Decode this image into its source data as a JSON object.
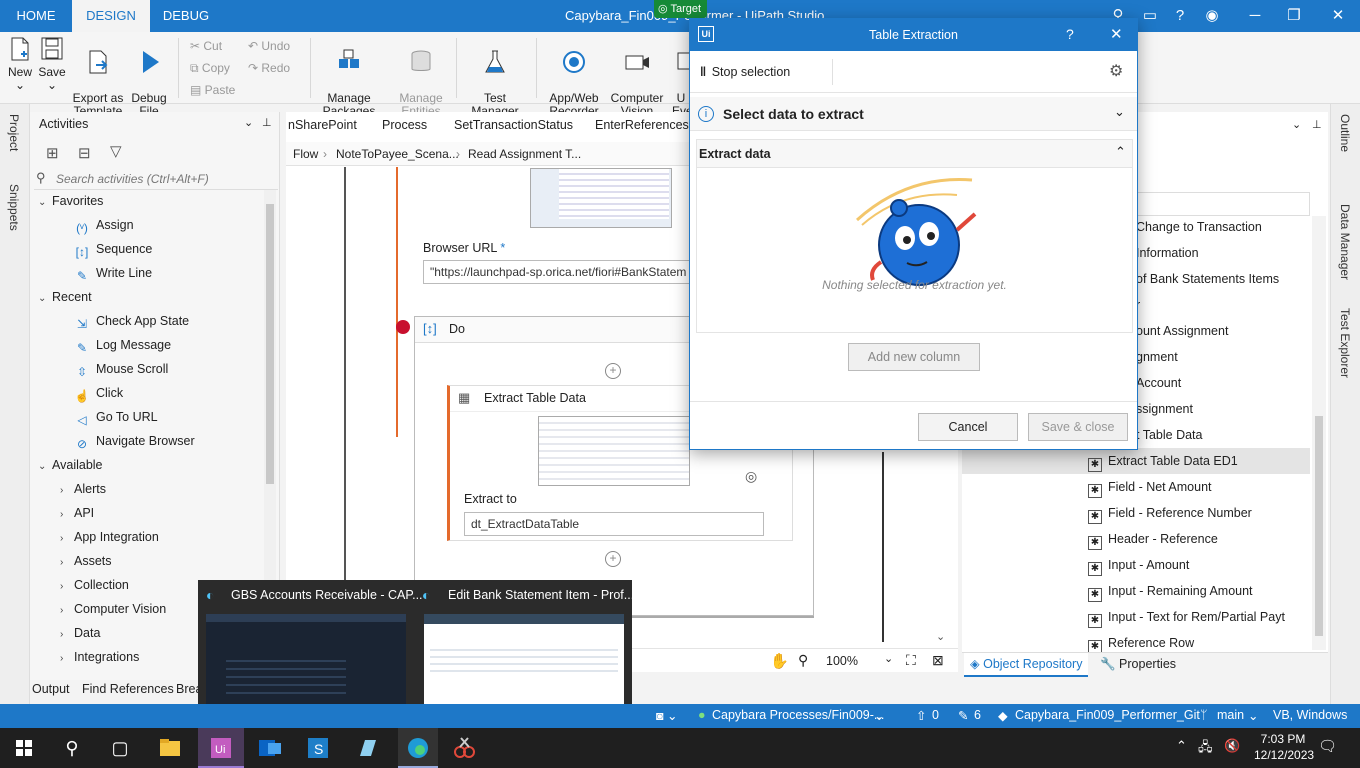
{
  "title_bar": {
    "tabs": [
      "HOME",
      "DESIGN",
      "DEBUG"
    ],
    "window_title": "Capybara_Fin009_Performer - UiPath Studio",
    "target_badge": "Target"
  },
  "ribbon": {
    "new": "New",
    "save": "Save",
    "export": "Export as\nTemplate",
    "debug": "Debug\nFile",
    "cut": "Cut",
    "copy": "Copy",
    "paste": "Paste",
    "undo": "Undo",
    "redo": "Redo",
    "manage_packages": "Manage\nPackages",
    "manage_entities": "Manage\nEntities",
    "test_manager": "Test\nManager",
    "recorder": "App/Web\nRecorder",
    "computer_vision": "Computer\nVision",
    "user_events": "U\nEve"
  },
  "left_rail": {
    "project": "Project",
    "snippets": "Snippets"
  },
  "activities": {
    "title": "Activities",
    "search_placeholder": "Search activities (Ctrl+Alt+F)",
    "groups": [
      {
        "label": "Favorites",
        "items": [
          "Assign",
          "Sequence",
          "Write Line"
        ]
      },
      {
        "label": "Recent",
        "items": [
          "Check App State",
          "Log Message",
          "Mouse Scroll",
          "Click",
          "Go To URL",
          "Navigate Browser"
        ]
      },
      {
        "label": "Available",
        "items": [
          "Alerts",
          "API",
          "App Integration",
          "Assets",
          "Collection",
          "Computer Vision",
          "Data",
          "Integrations"
        ]
      }
    ]
  },
  "designer": {
    "tabs": [
      "nSharePoint",
      "Process",
      "SetTransactionStatus",
      "EnterReferencesIn"
    ],
    "breadcrumb": [
      "Flow",
      "NoteToPayee_Scena...",
      "Read Assignment T..."
    ],
    "browser_url_label": "Browser URL",
    "browser_url_required": "*",
    "browser_url_value": "\"https://launchpad-sp.orica.net/fiori#BankStatem",
    "do_label": "Do",
    "extract_title": "Extract Table Data",
    "extract_to_label": "Extract to",
    "extract_to_value": "dt_ExtractDataTable",
    "zoom": "100%"
  },
  "object_repository": {
    "items": [
      "Change to Transaction",
      "Information",
      "of Bank Statements Items",
      "r",
      "ount Assignment",
      "gnment",
      "Account",
      "ssignment",
      "t Table Data",
      "Extract Table Data ED1",
      "Field - Net Amount",
      "Field - Reference Number",
      "Header - Reference",
      "Input - Amount",
      "Input - Remaining Amount",
      "Input - Text for Rem/Partial Payt",
      "Reference Row"
    ],
    "selected_index": 9,
    "tab_repo": "Object Repository",
    "tab_properties": "Properties"
  },
  "right_rail": {
    "outline": "Outline",
    "data_manager": "Data Manager",
    "test_explorer": "Test Explorer"
  },
  "dialog": {
    "title": "Table Extraction",
    "help": "?",
    "stop": "Stop selection",
    "select_data": "Select data to extract",
    "extract_data": "Extract data",
    "empty_msg": "Nothing selected for extraction yet.",
    "add_column": "Add new column",
    "cancel": "Cancel",
    "save_close": "Save & close"
  },
  "bottom_tabs": [
    "Output",
    "Find References",
    "Brea"
  ],
  "previews": [
    {
      "title": "GBS Accounts Receivable - CAP..."
    },
    {
      "title": "Edit Bank Statement Item - Prof..."
    }
  ],
  "status_bar": {
    "project": "Capybara Processes/Fin009-...",
    "up_count": "0",
    "edit_count": "6",
    "repo": "Capybara_Fin009_Performer_Git",
    "branch": "main",
    "lang": "VB, Windows"
  },
  "taskbar": {
    "time": "7:03 PM",
    "date": "12/12/2023"
  },
  "colors": {
    "accent": "#1e78c8",
    "badge": "#168a37",
    "breakpoint": "#c8102e"
  }
}
